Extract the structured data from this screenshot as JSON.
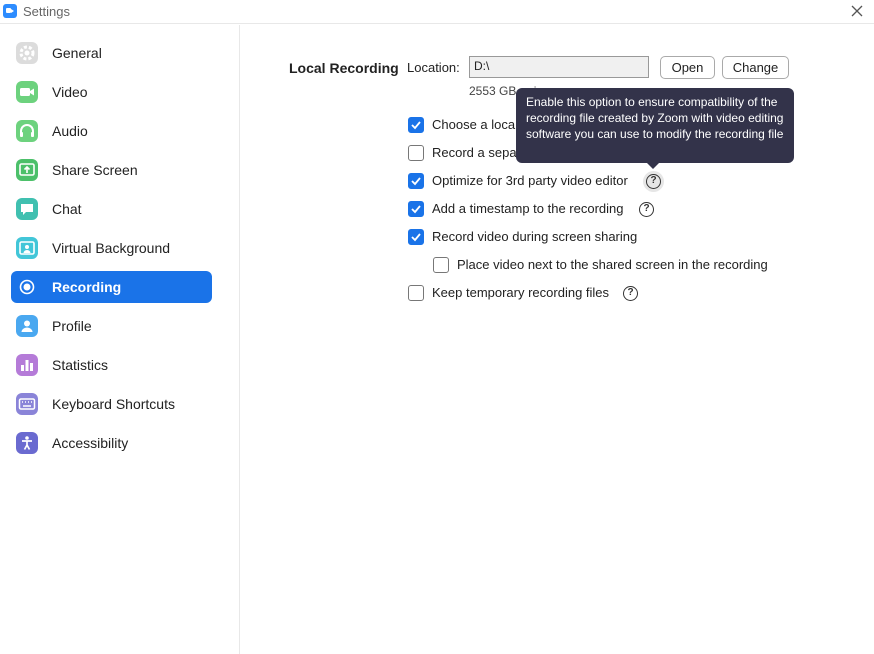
{
  "window": {
    "title": "Settings"
  },
  "sidebar": {
    "items": [
      {
        "label": "General",
        "icon": "gear-icon",
        "color": "#d6d6d6",
        "active": false
      },
      {
        "label": "Video",
        "icon": "video-camera-icon",
        "color": "#6dd27e",
        "active": false
      },
      {
        "label": "Audio",
        "icon": "headphones-icon",
        "color": "#6dd27e",
        "active": false
      },
      {
        "label": "Share Screen",
        "icon": "share-screen-icon",
        "color": "#4cc06a",
        "active": false
      },
      {
        "label": "Chat",
        "icon": "chat-bubble-icon",
        "color": "#40c0b0",
        "active": false
      },
      {
        "label": "Virtual Background",
        "icon": "person-background-icon",
        "color": "#42c6d8",
        "active": false
      },
      {
        "label": "Recording",
        "icon": "record-icon",
        "color": "#ffffff",
        "active": true
      },
      {
        "label": "Profile",
        "icon": "profile-icon",
        "color": "#4aa8f0",
        "active": false
      },
      {
        "label": "Statistics",
        "icon": "bar-chart-icon",
        "color": "#b57bd8",
        "active": false
      },
      {
        "label": "Keyboard Shortcuts",
        "icon": "keyboard-icon",
        "color": "#8a84d8",
        "active": false
      },
      {
        "label": "Accessibility",
        "icon": "accessibility-icon",
        "color": "#6a6ad0",
        "active": false
      }
    ]
  },
  "recording": {
    "section_title": "Local Recording",
    "location_label": "Location:",
    "location_value": "D:\\",
    "open_label": "Open",
    "change_label": "Change",
    "free_space": "2553 GB r        ai",
    "options": [
      {
        "label": "Choose a loca",
        "checked": true
      },
      {
        "label": "Record a sepa",
        "checked": false
      },
      {
        "label": "Optimize for 3rd party video editor",
        "checked": true,
        "help": true
      },
      {
        "label": "Add a timestamp to the recording",
        "checked": true,
        "help": true
      },
      {
        "label": "Record video during screen sharing",
        "checked": true
      },
      {
        "label": "Place video next to the shared screen in the recording",
        "checked": false
      },
      {
        "label": "Keep temporary recording files",
        "checked": false,
        "help": true
      }
    ],
    "help_glyph": "?",
    "tooltip": "Enable this option to ensure compatibility of the recording file created by Zoom with video editing software you can use to modify the recording file"
  },
  "colors": {
    "accent": "#1a73e8",
    "tooltip_bg": "#33334a"
  }
}
